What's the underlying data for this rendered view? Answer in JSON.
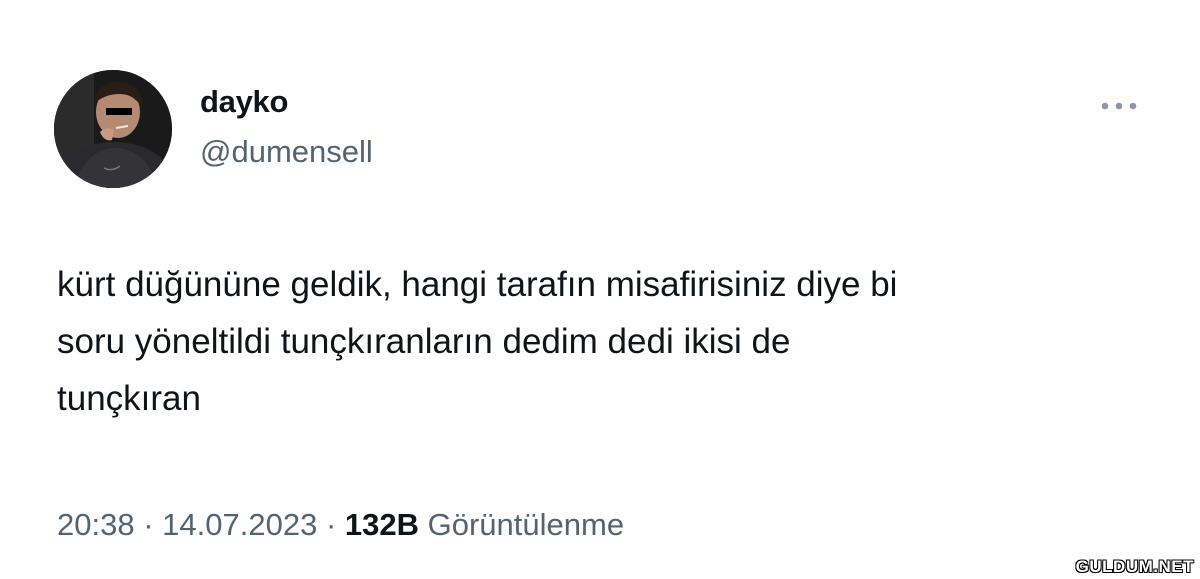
{
  "author": {
    "display_name": "dayko",
    "handle": "@dumensell",
    "avatar_icon": "profile-photo"
  },
  "more_icon": "more-horizontal-icon",
  "tweet": {
    "text": "kürt düğününe geldik, hangi tarafın misafirisiniz diye bi\nsoru yöneltildi tunçkıranların dedim dedi ikisi de\ntunçkıran"
  },
  "meta": {
    "time": "20:38",
    "separator": "·",
    "date": "14.07.2023",
    "views_count": "132B",
    "views_label": "Görüntülenme"
  },
  "watermark": "GULDUM.NET",
  "colors": {
    "text_primary": "#0f1419",
    "text_secondary": "#536471",
    "background": "#ffffff"
  }
}
